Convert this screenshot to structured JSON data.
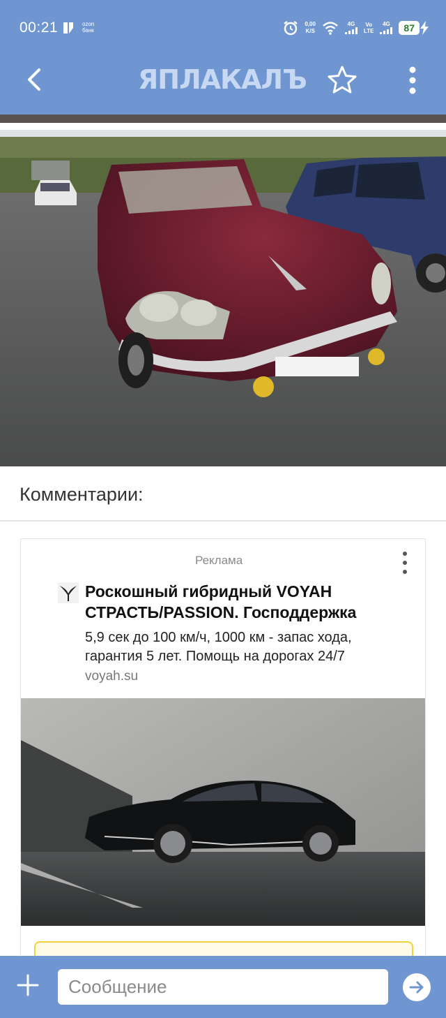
{
  "status_bar": {
    "time": "00:21",
    "ozon_line1": "ozon",
    "ozon_line2": "банк",
    "speed_value": "0,00",
    "speed_unit": "K/S",
    "net1": "4G",
    "volte_line1": "Vo",
    "volte_line2": "LTE",
    "net2": "4G",
    "battery": "87",
    "icons": [
      "alarm-icon",
      "wifi-icon",
      "signal-icon",
      "battery-icon",
      "charging-icon"
    ]
  },
  "app_bar": {
    "logo": "ЯПЛАКАЛЪ",
    "icons": [
      "back-arrow-icon",
      "star-icon",
      "more-vertical-icon"
    ]
  },
  "comments": {
    "title": "Комментарии:"
  },
  "ad": {
    "label": "Реклама",
    "title": "Роскошный гибридный VOYAH СТРАСТЬ/PASSION. Господдержка",
    "description": "5,9 сек до 100 км/ч, 1000 км - запас хода, гарантия 5 лет. Помощь на дорогах 24/7",
    "domain": "voyah.su"
  },
  "composer": {
    "placeholder": "Сообщение",
    "icons": [
      "plus-icon",
      "send-arrow-icon"
    ]
  },
  "colors": {
    "app_blue": "#6f96d1",
    "logo_color": "#c7d8f3",
    "battery_green": "#2e7d32",
    "ad_cta_border": "#f2d33a"
  }
}
